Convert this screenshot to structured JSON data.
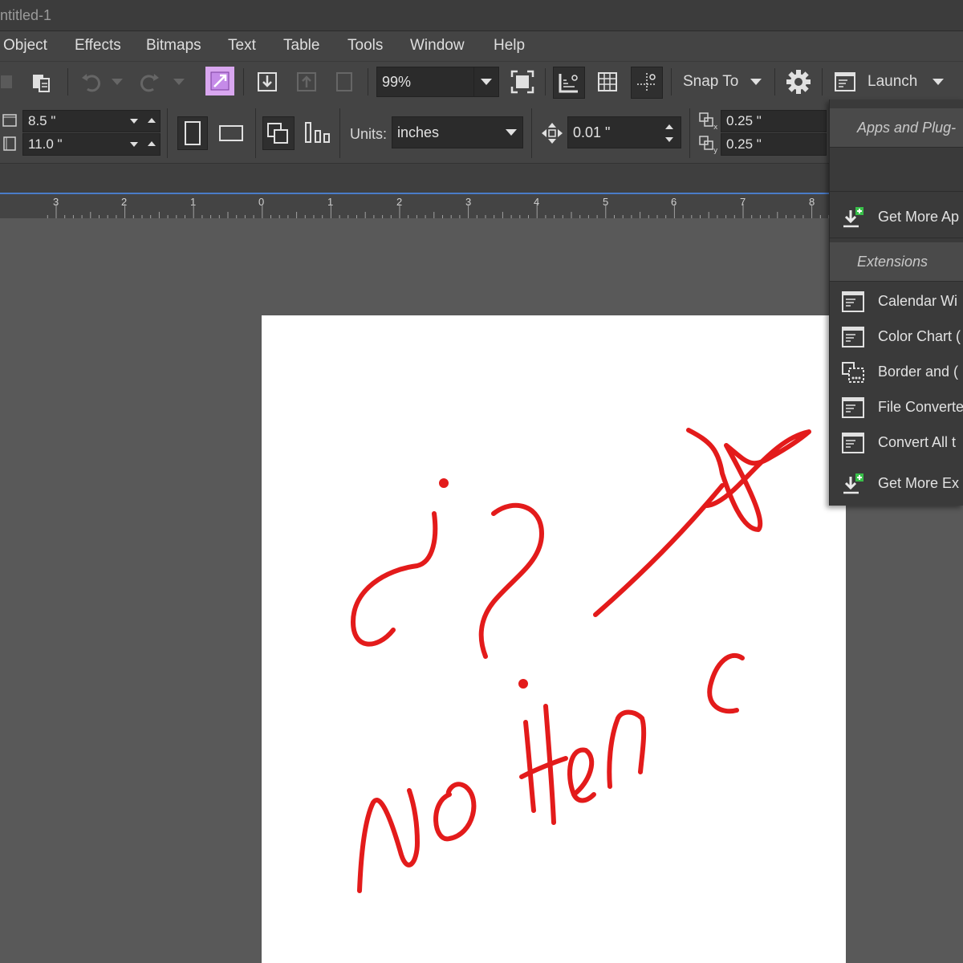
{
  "window": {
    "title": "ntitled-1"
  },
  "menu": {
    "items": [
      "Object",
      "Effects",
      "Bitmaps",
      "Text",
      "Table",
      "Tools",
      "Window",
      "Help"
    ]
  },
  "toolbar": {
    "zoom_value": "99%",
    "snap_to_label": "Snap To",
    "launch_label": "Launch"
  },
  "propbar": {
    "page_width": "8.5 \"",
    "page_height": "11.0 \"",
    "units_label": "Units:",
    "units_value": "inches",
    "nudge_value": "0.01 \"",
    "dup_x": "0.25 \"",
    "dup_y": "0.25 \""
  },
  "ruler": {
    "labels": [
      "3",
      "2",
      "1",
      "0",
      "1",
      "2",
      "3",
      "4",
      "5",
      "6",
      "7",
      "8"
    ]
  },
  "launch_menu": {
    "section_apps": "Apps and Plug-",
    "get_more_apps": "Get More Ap",
    "section_extensions": "Extensions",
    "extensions": [
      "Calendar Wi",
      "Color Chart (",
      "Border and (",
      "File Converte",
      "Convert All t"
    ],
    "get_more_ext": "Get More Ex"
  },
  "annotation": {
    "handwritten_text": "no Here",
    "color": "#e31b1b"
  }
}
